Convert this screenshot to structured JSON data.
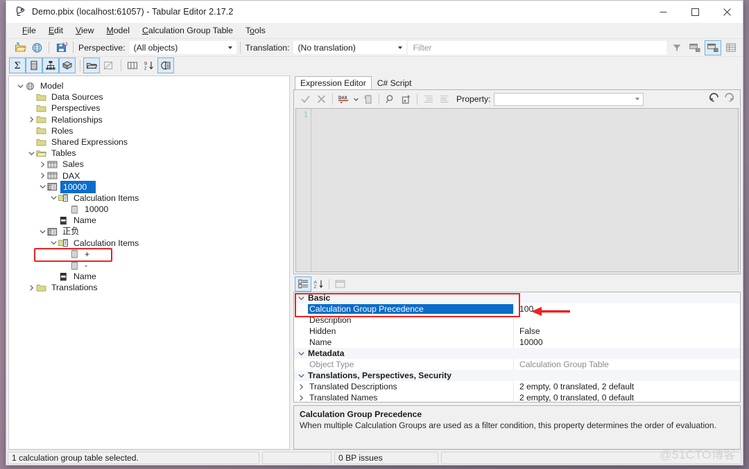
{
  "window": {
    "title": "Demo.pbix (localhost:61057) - Tabular Editor 2.17.2",
    "app_icon": "tabular-editor-icon",
    "minimize": "—",
    "maximize": "□",
    "close": "✕"
  },
  "menubar": {
    "items": [
      {
        "label": "File",
        "accel": "F"
      },
      {
        "label": "Edit",
        "accel": "E"
      },
      {
        "label": "View",
        "accel": "V"
      },
      {
        "label": "Model",
        "accel": "M"
      },
      {
        "label": "Calculation Group Table",
        "accel": "C"
      },
      {
        "label": "Tools",
        "accel": "o"
      }
    ]
  },
  "toolbar_main": {
    "icons": [
      "open-folder-icon",
      "globe-model-icon",
      "save-icon"
    ],
    "perspective_label": "Perspective:",
    "perspective_value": "(All objects)",
    "translation_label": "Translation:",
    "translation_value": "(No translation)",
    "filter_placeholder": "Filter",
    "filter_value": "",
    "right_icons": [
      "funnel-filter-icon",
      "show-hidden-icon",
      "display-folders-icon",
      "table-grid-icon"
    ]
  },
  "toolbar_objects": {
    "icons": [
      {
        "name": "measures-sigma-icon",
        "active": true
      },
      {
        "name": "columns-icon",
        "active": true
      },
      {
        "name": "hierarchies-icon",
        "active": true
      },
      {
        "name": "partitions-icon",
        "active": true
      },
      {
        "name": "tables-icon",
        "active": true
      },
      {
        "name": "relationships-icon",
        "active": false
      },
      {
        "name": "all-columns-icon",
        "active": false
      },
      {
        "name": "sort-order-icon",
        "active": false
      },
      {
        "name": "calculation-groups-icon",
        "active": true
      }
    ]
  },
  "tree": {
    "nodes": [
      {
        "label": "Model",
        "indent": 0,
        "icon": "model-globe-icon",
        "expander": "down"
      },
      {
        "label": "Data Sources",
        "indent": 1,
        "icon": "folder-icon",
        "expander": "none"
      },
      {
        "label": "Perspectives",
        "indent": 1,
        "icon": "folder-icon",
        "expander": "none"
      },
      {
        "label": "Relationships",
        "indent": 1,
        "icon": "folder-icon",
        "expander": "right"
      },
      {
        "label": "Roles",
        "indent": 1,
        "icon": "folder-icon",
        "expander": "none"
      },
      {
        "label": "Shared Expressions",
        "indent": 1,
        "icon": "folder-icon",
        "expander": "none"
      },
      {
        "label": "Tables",
        "indent": 1,
        "icon": "tables-folder-icon",
        "expander": "down"
      },
      {
        "label": "Sales",
        "indent": 2,
        "icon": "table-icon",
        "expander": "right"
      },
      {
        "label": "DAX",
        "indent": 2,
        "icon": "table-icon",
        "expander": "right"
      },
      {
        "label": "10000",
        "indent": 2,
        "icon": "calc-group-table-icon",
        "expander": "down",
        "selected": true
      },
      {
        "label": "Calculation Items",
        "indent": 3,
        "icon": "calc-items-folder-icon",
        "expander": "down"
      },
      {
        "label": "10000",
        "indent": 4,
        "icon": "calc-item-icon",
        "expander": "none"
      },
      {
        "label": "Name",
        "indent": 3,
        "icon": "column-icon",
        "expander": "none"
      },
      {
        "label": "正负",
        "indent": 2,
        "icon": "calc-group-table-icon",
        "expander": "down"
      },
      {
        "label": "Calculation Items",
        "indent": 3,
        "icon": "calc-items-folder-icon",
        "expander": "down"
      },
      {
        "label": "+",
        "indent": 4,
        "icon": "calc-item-icon",
        "expander": "none"
      },
      {
        "label": "-",
        "indent": 4,
        "icon": "calc-item-icon",
        "expander": "none"
      },
      {
        "label": "Name",
        "indent": 3,
        "icon": "column-icon",
        "expander": "none"
      },
      {
        "label": "Translations",
        "indent": 1,
        "icon": "folder-icon",
        "expander": "right"
      }
    ]
  },
  "editor": {
    "tabs": [
      {
        "label": "Expression Editor",
        "active": true
      },
      {
        "label": "C# Script",
        "active": false
      }
    ],
    "toolbar_icons": [
      "accept-check-icon",
      "cancel-x-icon",
      "dax-format-icon",
      "dax-dropdown-icon",
      "paste-icon",
      "find-icon",
      "replace-icon",
      "indent-icon",
      "outdent-icon"
    ],
    "property_label": "Property:",
    "property_value": "",
    "nav_icons": [
      "back-circle-icon",
      "forward-circle-icon"
    ],
    "line_number": "1",
    "content": ""
  },
  "properties": {
    "toolbar_icons": [
      {
        "name": "categorized-view-icon",
        "active": true
      },
      {
        "name": "alphabetical-sort-icon",
        "active": false
      },
      {
        "name": "property-pages-icon",
        "active": false
      }
    ],
    "rows": [
      {
        "type": "category",
        "name": "Basic"
      },
      {
        "type": "prop",
        "name": "Calculation Group Precedence",
        "value": "100",
        "selected": true
      },
      {
        "type": "prop",
        "name": "Description",
        "value": ""
      },
      {
        "type": "prop",
        "name": "Hidden",
        "value": "False"
      },
      {
        "type": "prop",
        "name": "Name",
        "value": "10000"
      },
      {
        "type": "category",
        "name": "Metadata"
      },
      {
        "type": "prop",
        "name": "Object Type",
        "value": "Calculation Group Table",
        "dim": true
      },
      {
        "type": "category",
        "name": "Translations, Perspectives, Security"
      },
      {
        "type": "prop",
        "name": "Translated Descriptions",
        "value": "2 empty, 0 translated, 2 default",
        "expandable": true
      },
      {
        "type": "prop",
        "name": "Translated Names",
        "value": "2 empty, 0 translated, 0 default",
        "expandable": true
      }
    ]
  },
  "description": {
    "title": "Calculation Group Precedence",
    "text": "When multiple Calculation Groups are used as a filter condition, this property determines the order of evaluation."
  },
  "statusbar": {
    "main": "1 calculation group table selected.",
    "middle": "",
    "bp_issues": "0 BP issues",
    "last": ""
  },
  "annotations": {
    "highlight_color": "#ee2222",
    "selection_color": "#0a6dc9",
    "arrow_label": "red-arrow-pointing-to-value"
  },
  "watermark": "@51CTO博客"
}
